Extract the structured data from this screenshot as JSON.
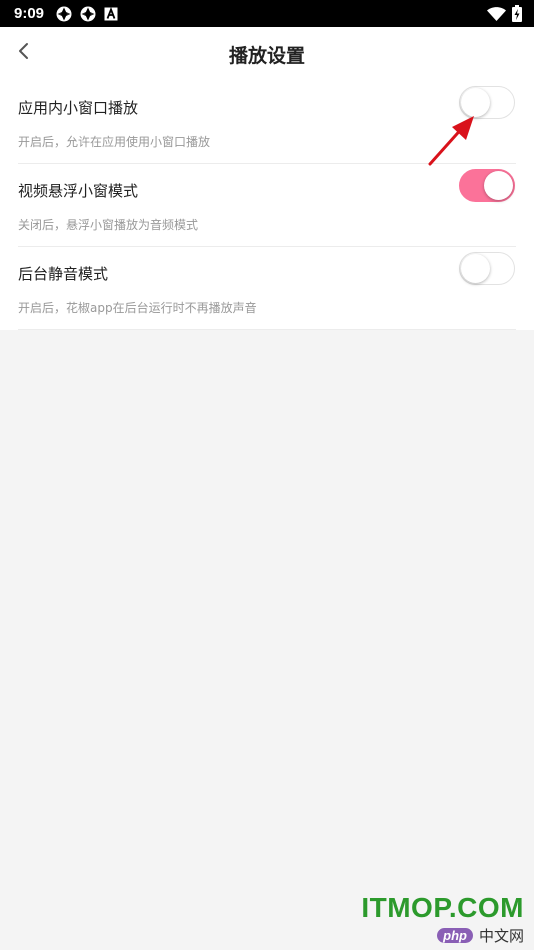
{
  "status_bar": {
    "time": "9:09",
    "icons_left": [
      "aperture-icon",
      "aperture-icon",
      "text-a-icon"
    ],
    "icons_right": [
      "wifi-icon",
      "battery-charging-icon"
    ]
  },
  "header": {
    "back_icon": "chevron-left-icon",
    "title": "播放设置"
  },
  "settings": [
    {
      "title": "应用内小窗口播放",
      "description": "开启后，允许在应用使用小窗口播放",
      "enabled": false
    },
    {
      "title": "视频悬浮小窗模式",
      "description": "关闭后，悬浮小窗播放为音频模式",
      "enabled": true
    },
    {
      "title": "后台静音模式",
      "description": "开启后，花椒app在后台运行时不再播放声音",
      "enabled": false
    }
  ],
  "annotation": {
    "type": "red-arrow",
    "target": "settings.0 toggle"
  },
  "watermark": {
    "main": "ITMOP.COM",
    "badge": "php",
    "sub": "中文网"
  },
  "colors": {
    "accent": "#fb7299",
    "background": "#f4f4f4",
    "status_bar": "#000000",
    "annotation": "#d9121b"
  }
}
